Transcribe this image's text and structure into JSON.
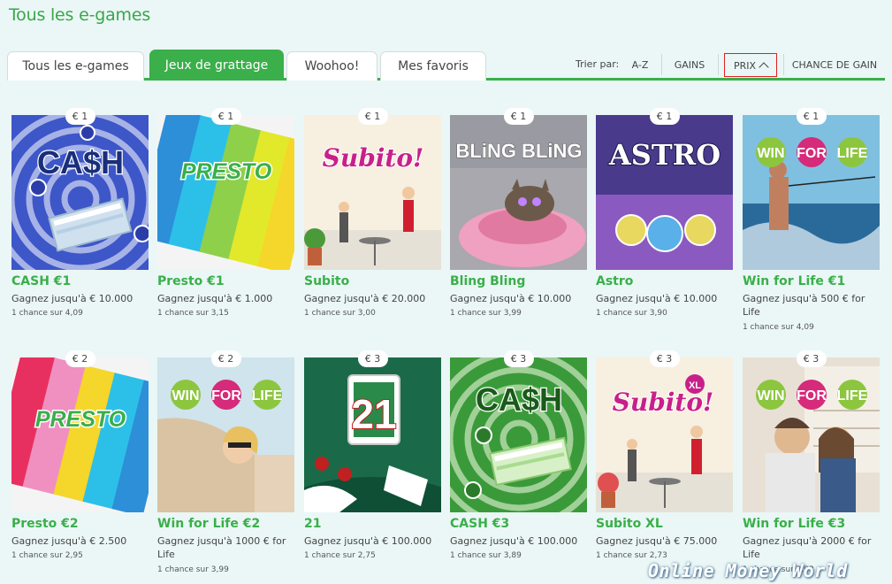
{
  "page": {
    "title": "Tous les e-games"
  },
  "tabs": [
    {
      "label": "Tous les e-games",
      "active": false
    },
    {
      "label": "Jeux de grattage",
      "active": true
    },
    {
      "label": "Woohoo!",
      "active": false
    },
    {
      "label": "Mes favoris",
      "active": false
    }
  ],
  "sort": {
    "label": "Trier par:",
    "options": [
      "A-Z",
      "GAINS",
      "PRIX",
      "CHANCE DE GAIN"
    ],
    "selected": "PRIX"
  },
  "colors": {
    "brand_green": "#3aaf4a",
    "background": "#eaf7f6",
    "selected_outline": "#e02020"
  },
  "games": [
    {
      "price": "€ 1",
      "name": "CASH €1",
      "win": "Gagnez jusqu'à € 10.000",
      "chance": "1 chance sur 4,09",
      "art_text": "CA$H"
    },
    {
      "price": "€ 1",
      "name": "Presto €1",
      "win": "Gagnez jusqu'à € 1.000",
      "chance": "1 chance sur 3,15",
      "art_text": "PRESTO"
    },
    {
      "price": "€ 1",
      "name": "Subito",
      "win": "Gagnez jusqu'à € 20.000",
      "chance": "1 chance sur 3,00",
      "art_text": "Subito!"
    },
    {
      "price": "€ 1",
      "name": "Bling Bling",
      "win": "Gagnez jusqu'à € 10.000",
      "chance": "1 chance sur 3,99",
      "art_text": "BLiNG BLiNG"
    },
    {
      "price": "€ 1",
      "name": "Astro",
      "win": "Gagnez jusqu'à € 10.000",
      "chance": "1 chance sur 3,90",
      "art_text": "ASTRO"
    },
    {
      "price": "€ 1",
      "name": "Win for Life €1",
      "win": "Gagnez jusqu'à 500 € for Life",
      "chance": "1 chance sur 4,09",
      "art_text": [
        "WIN",
        "FOR",
        "LIFE"
      ]
    },
    {
      "price": "€ 2",
      "name": "Presto €2",
      "win": "Gagnez jusqu'à € 2.500",
      "chance": "1 chance sur 2,95",
      "art_text": "PRESTO"
    },
    {
      "price": "€ 2",
      "name": "Win for Life €2",
      "win": "Gagnez jusqu'à 1000 € for Life",
      "chance": "1 chance sur 3,99",
      "art_text": [
        "WIN",
        "FOR",
        "LIFE"
      ]
    },
    {
      "price": "€ 3",
      "name": "21",
      "win": "Gagnez jusqu'à € 100.000",
      "chance": "1 chance sur 2,75",
      "art_text": "21"
    },
    {
      "price": "€ 3",
      "name": "CASH €3",
      "win": "Gagnez jusqu'à € 100.000",
      "chance": "1 chance sur 3,89",
      "art_text": "CA$H"
    },
    {
      "price": "€ 3",
      "name": "Subito XL",
      "win": "Gagnez jusqu'à € 75.000",
      "chance": "1 chance sur 2,73",
      "art_text": "Subito!",
      "art_badge": "XL"
    },
    {
      "price": "€ 3",
      "name": "Win for Life €3",
      "win": "Gagnez jusqu'à 2000 € for Life",
      "chance": "1 chance sur 3,93",
      "art_text": [
        "WIN",
        "FOR",
        "LIFE"
      ]
    }
  ],
  "watermark": "Online Money World"
}
